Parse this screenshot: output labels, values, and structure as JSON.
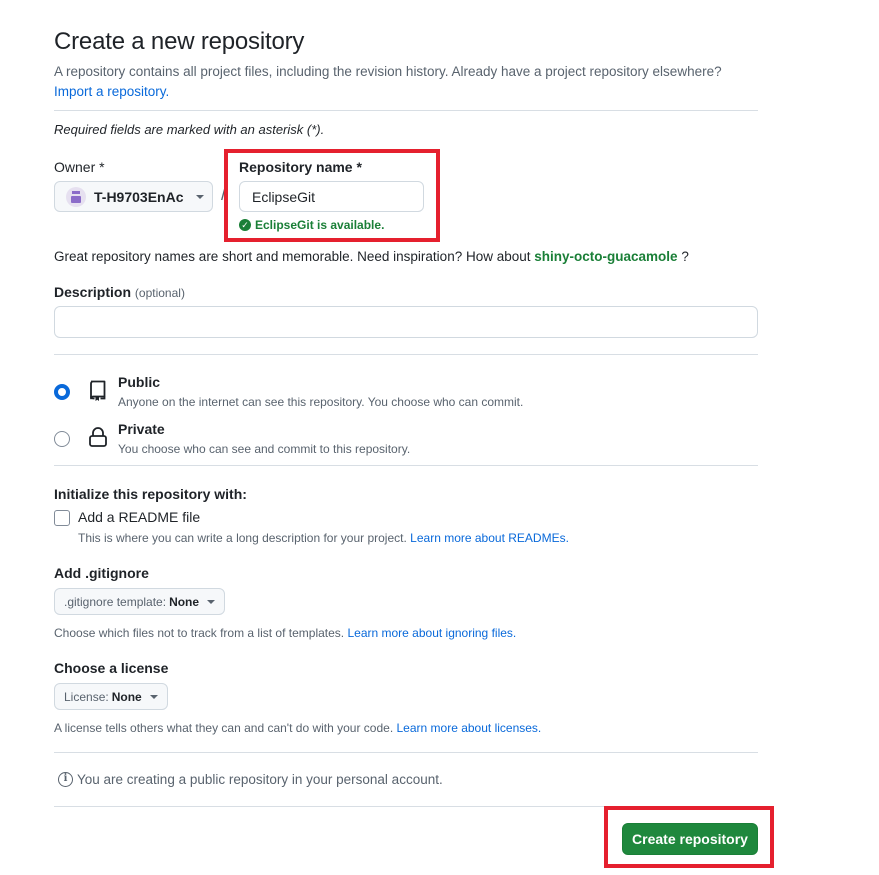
{
  "page": {
    "title": "Create a new repository",
    "subtitle": "A repository contains all project files, including the revision history. Already have a project repository elsewhere?",
    "import_link": "Import a repository.",
    "required_note": "Required fields are marked with an asterisk (*)."
  },
  "owner": {
    "label": "Owner *",
    "value": "T-H9703EnAc",
    "separator": "/"
  },
  "repository_name": {
    "label": "Repository name *",
    "value": "EclipseGit",
    "availability": "EclipseGit is available."
  },
  "inspiration": {
    "text": "Great repository names are short and memorable. Need inspiration? How about",
    "suggestion": "shiny-octo-guacamole",
    "suffix": "?"
  },
  "description": {
    "label": "Description",
    "optional": "(optional)",
    "value": ""
  },
  "visibility": {
    "selected": "public",
    "options": [
      {
        "id": "public",
        "title": "Public",
        "description": "Anyone on the internet can see this repository. You choose who can commit.",
        "icon": "repo-icon"
      },
      {
        "id": "private",
        "title": "Private",
        "description": "You choose who can see and commit to this repository.",
        "icon": "lock-icon"
      }
    ]
  },
  "initialize": {
    "label": "Initialize this repository with:",
    "readme": {
      "label": "Add a README file",
      "checked": false,
      "description": "This is where you can write a long description for your project.",
      "link": "Learn more about READMEs."
    }
  },
  "gitignore": {
    "label": "Add .gitignore",
    "select_prefix": ".gitignore template:",
    "select_value": "None",
    "description": "Choose which files not to track from a list of templates.",
    "link": "Learn more about ignoring files."
  },
  "license": {
    "label": "Choose a license",
    "select_prefix": "License:",
    "select_value": "None",
    "description": "A license tells others what they can and can't do with your code.",
    "link": "Learn more about licenses."
  },
  "info_note": "You are creating a public repository in your personal account.",
  "create_button": "Create repository",
  "colors": {
    "primary_button": "#1f883d",
    "link": "#0969da",
    "success": "#1a7f37",
    "highlight_box": "#e5202e"
  }
}
